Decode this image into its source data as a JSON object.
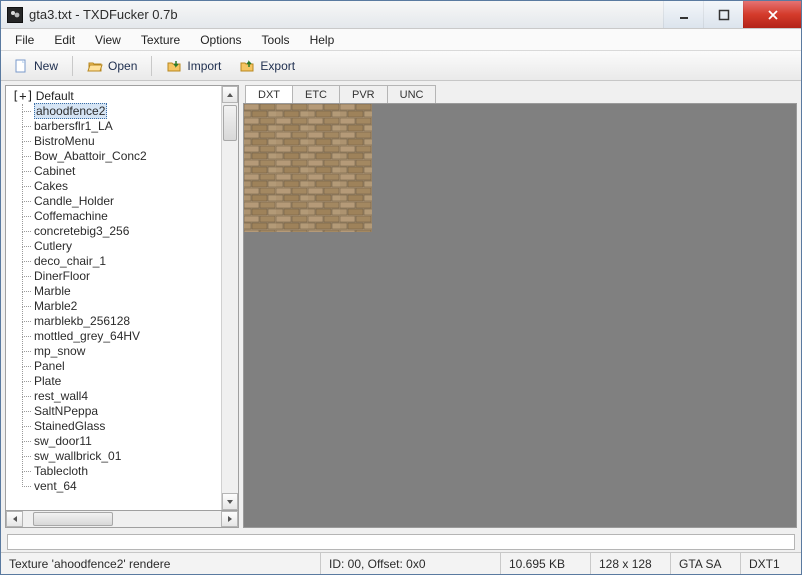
{
  "window": {
    "title": "gta3.txt - TXDFucker 0.7b"
  },
  "menu": {
    "file": "File",
    "edit": "Edit",
    "view": "View",
    "texture": "Texture",
    "options": "Options",
    "tools": "Tools",
    "help": "Help"
  },
  "toolbar": {
    "new": "New",
    "open": "Open",
    "import": "Import",
    "export": "Export"
  },
  "tree": {
    "root": "Default",
    "items": [
      "ahoodfence2",
      "barbersflr1_LA",
      "BistroMenu",
      "Bow_Abattoir_Conc2",
      "Cabinet",
      "Cakes",
      "Candle_Holder",
      "Coffemachine",
      "concretebig3_256",
      "Cutlery",
      "deco_chair_1",
      "DinerFloor",
      "Marble",
      "Marble2",
      "marblekb_256128",
      "mottled_grey_64HV",
      "mp_snow",
      "Panel",
      "Plate",
      "rest_wall4",
      "SaltNPeppa",
      "StainedGlass",
      "sw_door11",
      "sw_wallbrick_01",
      "Tablecloth",
      "vent_64"
    ],
    "selected": 0
  },
  "tabs": {
    "dxt": "DXT",
    "etc": "ETC",
    "pvr": "PVR",
    "unc": "UNC",
    "active": "dxt"
  },
  "status": {
    "left": "Texture 'ahoodfence2' rendere",
    "id_offset": "ID: 00, Offset: 0x0",
    "size_kb": "10.695 KB",
    "dims": "128 x 128",
    "game": "GTA SA",
    "format": "DXT1"
  }
}
